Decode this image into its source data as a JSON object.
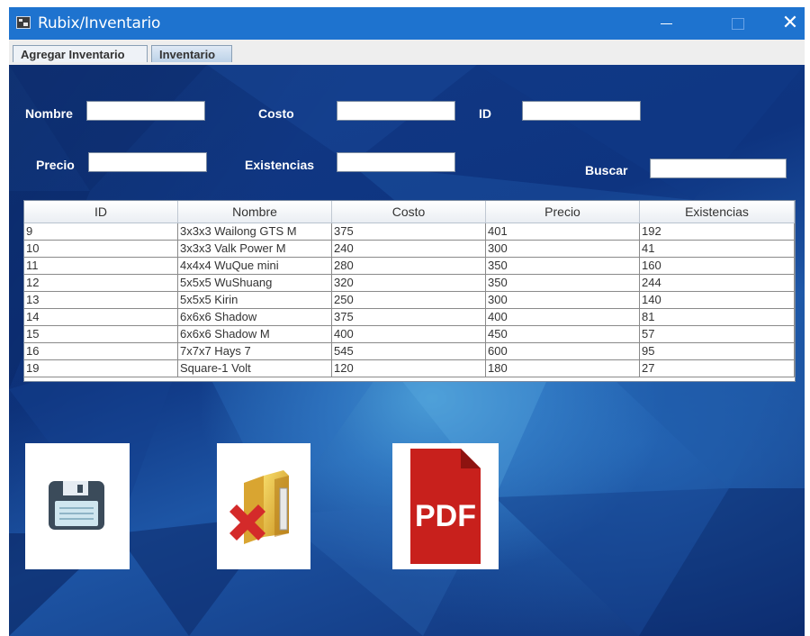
{
  "window": {
    "title": "Rubix/Inventario",
    "close_glyph": "✕"
  },
  "tabs": [
    {
      "label": "Agregar Inventario",
      "active": false
    },
    {
      "label": "Inventario",
      "active": true
    }
  ],
  "form": {
    "nombre_label": "Nombre",
    "nombre_value": "",
    "costo_label": "Costo",
    "costo_value": "",
    "id_label": "ID",
    "id_value": "",
    "precio_label": "Precio",
    "precio_value": "",
    "existencias_label": "Existencias",
    "existencias_value": "",
    "buscar_label": "Buscar",
    "buscar_value": ""
  },
  "table": {
    "columns": [
      "ID",
      "Nombre",
      "Costo",
      "Precio",
      "Existencias"
    ],
    "rows": [
      [
        "9",
        "3x3x3 Wailong GTS M",
        "375",
        "401",
        "192"
      ],
      [
        "10",
        "3x3x3 Valk Power M",
        "240",
        "300",
        "41"
      ],
      [
        "11",
        "4x4x4 WuQue mini",
        "280",
        "350",
        "160"
      ],
      [
        "12",
        "5x5x5 WuShuang",
        "320",
        "350",
        "244"
      ],
      [
        "13",
        "5x5x5 Kirin",
        "250",
        "300",
        "140"
      ],
      [
        "14",
        "6x6x6 Shadow",
        "375",
        "400",
        "81"
      ],
      [
        "15",
        "6x6x6 Shadow M",
        "400",
        "450",
        "57"
      ],
      [
        "16",
        "7x7x7 Hays 7",
        "545",
        "600",
        "95"
      ],
      [
        "19",
        "Square-1 Volt",
        "120",
        "180",
        "27"
      ]
    ]
  },
  "actions": {
    "save_icon": "floppy-disk-icon",
    "delete_icon": "folder-delete-icon",
    "pdf_icon": "pdf-document-icon",
    "pdf_text": "PDF"
  },
  "colors": {
    "titlebar": "#1e73cf",
    "background": "#123a86",
    "pdf_red": "#c8201c",
    "floppy": "#3b4b5a"
  }
}
